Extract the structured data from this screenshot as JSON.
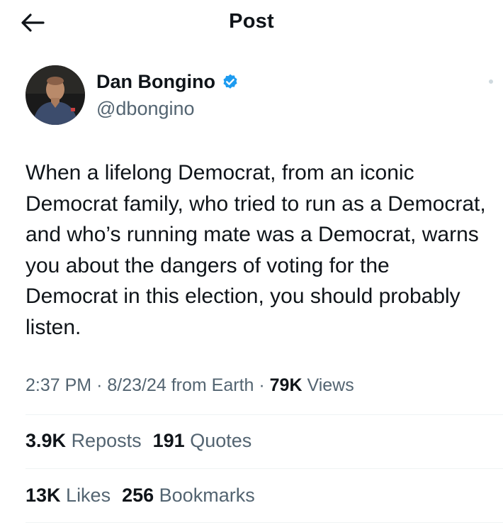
{
  "header": {
    "title": "Post"
  },
  "author": {
    "name": "Dan Bongino",
    "handle": "@dbongino"
  },
  "tweet": {
    "text": "When a lifelong Democrat, from an iconic Democrat family, who tried to run as a Democrat, and who’s running mate was a Democrat, warns you about the dangers of voting for the Democrat in this election, you should probably listen."
  },
  "meta": {
    "time": "2:37 PM",
    "date": "8/23/24",
    "source": "from Earth",
    "views_count": "79K",
    "views_label": "Views"
  },
  "stats": {
    "reposts_count": "3.9K",
    "reposts_label": "Reposts",
    "quotes_count": "191",
    "quotes_label": "Quotes",
    "likes_count": "13K",
    "likes_label": "Likes",
    "bookmarks_count": "256",
    "bookmarks_label": "Bookmarks"
  },
  "colors": {
    "verified": "#1d9bf0",
    "text_primary": "#0f1419",
    "text_secondary": "#536471",
    "divider": "#eff3f4"
  },
  "icons": {
    "back": "arrow-left-icon",
    "verified": "verified-badge-icon"
  }
}
